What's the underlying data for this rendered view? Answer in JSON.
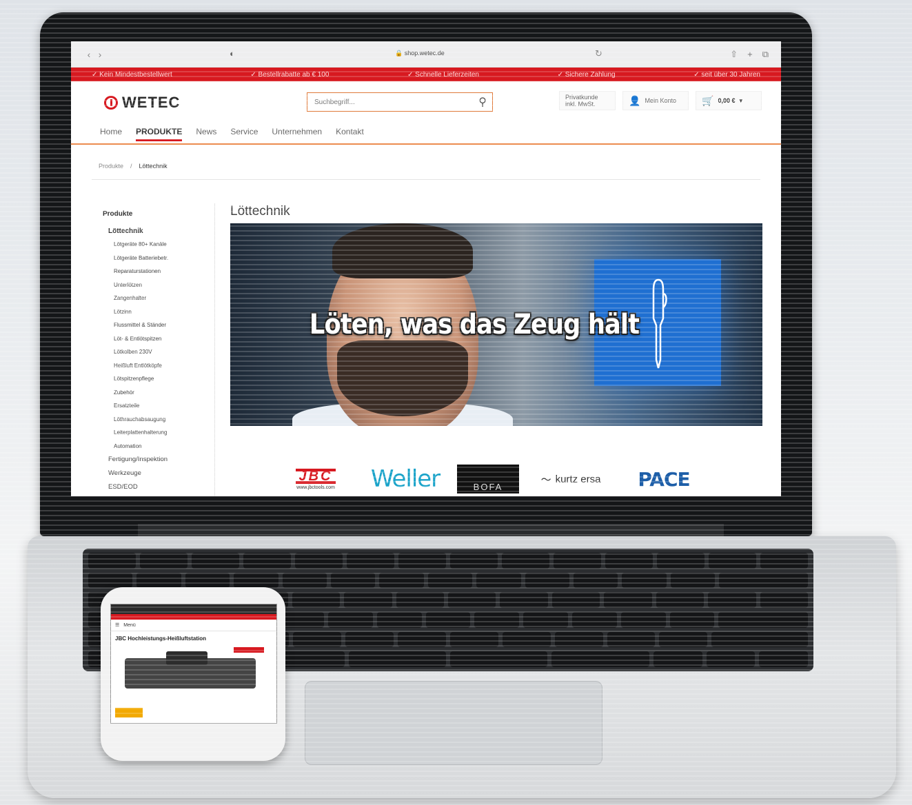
{
  "browser": {
    "url": "shop.wetec.de",
    "back_icon": "chevron-left-icon",
    "forward_icon": "chevron-right-icon"
  },
  "usp_bar": {
    "items": [
      "✓ Kein Mindestbestellwert",
      "✓ Bestellrabatte ab € 100",
      "✓ Schnelle Lieferzeiten",
      "✓ Sichere Zahlung",
      "✓ seit über 30 Jahren"
    ],
    "color": "#d71920"
  },
  "header": {
    "logo_text": "WETEC",
    "search_placeholder": "Suchbegriff...",
    "customer_type_line1": "Privatkunde",
    "customer_type_line2": "inkl. MwSt.",
    "account_label": "Mein Konto",
    "cart_total": "0,00 €"
  },
  "main_nav": {
    "items": [
      "Home",
      "PRODUKTE",
      "News",
      "Service",
      "Unternehmen",
      "Kontakt"
    ],
    "active": "PRODUKTE"
  },
  "breadcrumb": {
    "items": [
      "Produkte",
      "/",
      "Löttechnik"
    ]
  },
  "sidebar": {
    "root": "Produkte",
    "category": "Löttechnik",
    "subcategories": [
      "Lötgeräte 80+ Kanäle",
      "Lötgeräte Batteriebetr.",
      "Reparaturstationen",
      "Unterlötzen",
      "Zangenhalter",
      "Lötzinn",
      "Flussmittel & Ständer",
      "Löt- & Entlötspitzen",
      "Lötkolben 230V",
      "Heißluft Entlötköpfe",
      "Lötspitzenpflege",
      "Zubehör",
      "Ersatzteile",
      "Löthrauchabsaugung",
      "Leiterplattenhalterung",
      "Automation"
    ],
    "more_categories": [
      "Fertigung/Inspektion",
      "Werkzeuge",
      "ESD/EOD"
    ]
  },
  "page": {
    "title": "Löttechnik",
    "hero_text": "Löten, was das Zeug hält"
  },
  "brands": {
    "jbc": "JBC",
    "jbc_url": "www.jbctools.com",
    "weller": "Weller",
    "bofa": "BOFA",
    "kurtz": "kurtz ersa",
    "pace": "PACE"
  },
  "phone": {
    "nav_label": "Menü",
    "product_title": "JBC Hochleistungs-Heißluftstation"
  }
}
